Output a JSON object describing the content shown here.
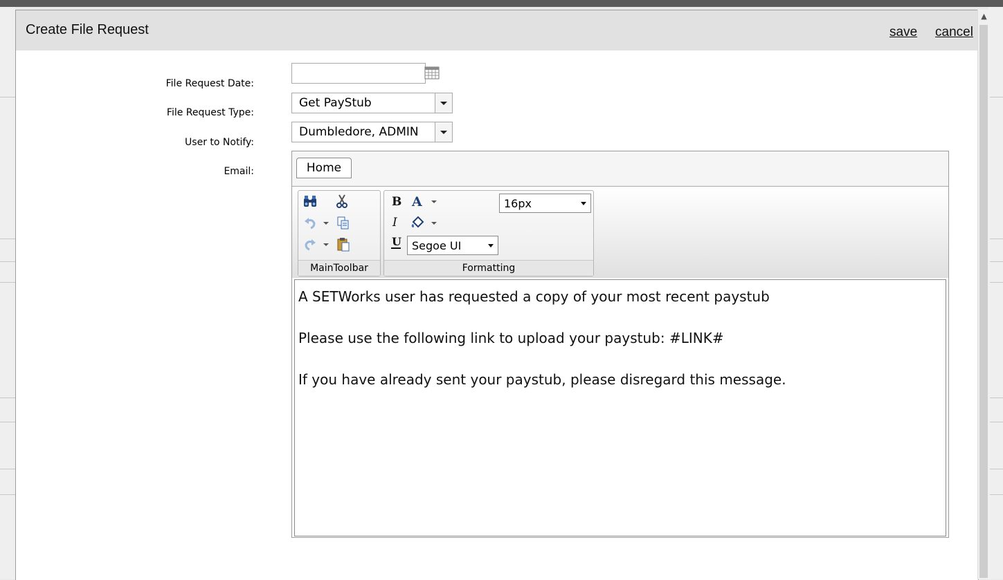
{
  "dialog": {
    "title": "Create File Request",
    "save_label": "save",
    "cancel_label": "cancel"
  },
  "form": {
    "date_label": "File Request Date:",
    "date_value": "",
    "type_label": "File Request Type:",
    "type_value": "Get PayStub",
    "user_label": "User to Notify:",
    "user_value": "Dumbledore, ADMIN",
    "email_label": "Email:"
  },
  "editor": {
    "tab_home": "Home",
    "groups": {
      "main_caption": "MainToolbar",
      "formatting_caption": "Formatting"
    },
    "font_size": "16px",
    "font_name": "Segoe UI",
    "content": {
      "line1": "A SETWorks user has requested a copy of your most recent paystub",
      "line2": "Please use the following link to upload your paystub: #LINK#",
      "line3": "If you have already sent your paystub, please disregard this message."
    }
  },
  "icons": {
    "find": "binoculars-icon",
    "cut": "scissors-icon",
    "undo": "undo-icon",
    "redo": "redo-icon",
    "copy": "copy-icon",
    "paste": "paste-icon",
    "bold": "bold-icon",
    "italic": "italic-icon",
    "underline": "underline-icon",
    "forecolor": "font-color-icon",
    "backcolor": "highlight-color-icon",
    "calendar": "calendar-icon"
  }
}
